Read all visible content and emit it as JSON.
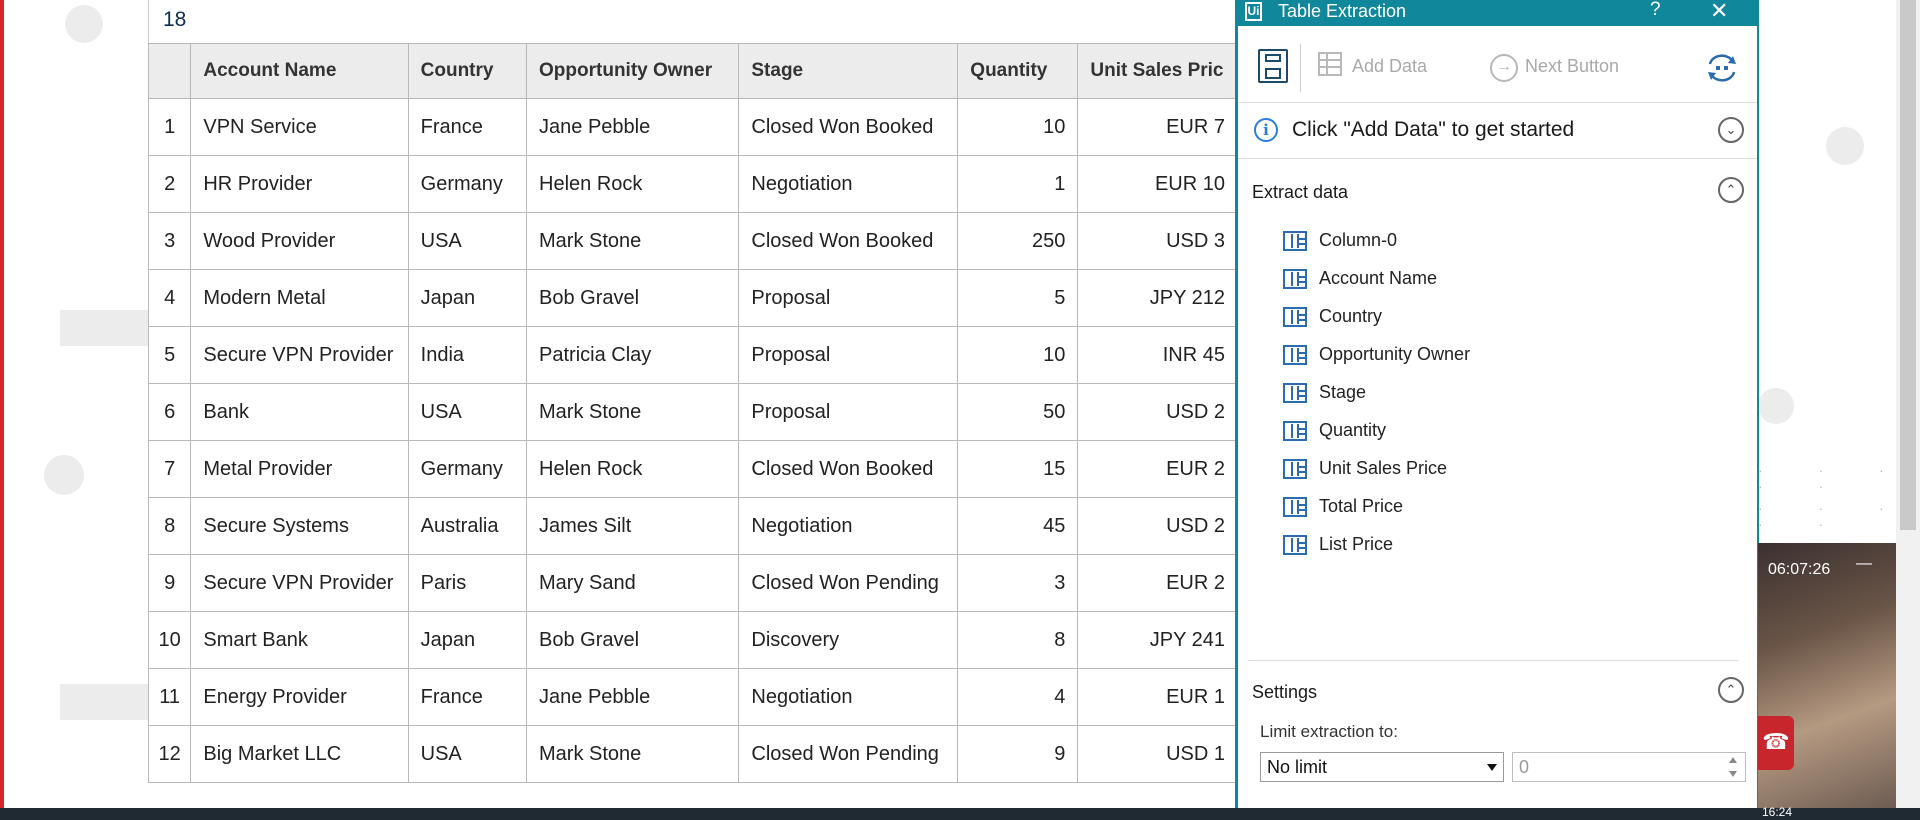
{
  "table": {
    "record_count": "18",
    "columns": [
      "",
      "Account Name",
      "Country",
      "Opportunity Owner",
      "Stage",
      "Quantity",
      "Unit Sales Pric"
    ],
    "rows": [
      [
        "1",
        "VPN Service",
        "France",
        "Jane Pebble",
        "Closed Won Booked",
        "10",
        "EUR 7"
      ],
      [
        "2",
        "HR Provider",
        "Germany",
        "Helen Rock",
        "Negotiation",
        "1",
        "EUR 10"
      ],
      [
        "3",
        "Wood Provider",
        "USA",
        "Mark Stone",
        "Closed Won Booked",
        "250",
        "USD 3"
      ],
      [
        "4",
        "Modern Metal",
        "Japan",
        "Bob Gravel",
        "Proposal",
        "5",
        "JPY 212"
      ],
      [
        "5",
        "Secure VPN Provider",
        "India",
        "Patricia Clay",
        "Proposal",
        "10",
        "INR 45"
      ],
      [
        "6",
        "Bank",
        "USA",
        "Mark Stone",
        "Proposal",
        "50",
        "USD 2"
      ],
      [
        "7",
        "Metal Provider",
        "Germany",
        "Helen Rock",
        "Closed Won Booked",
        "15",
        "EUR 2"
      ],
      [
        "8",
        "Secure Systems",
        "Australia",
        "James Silt",
        "Negotiation",
        "45",
        "USD 2"
      ],
      [
        "9",
        "Secure VPN Provider",
        "Paris",
        "Mary Sand",
        "Closed Won Pending",
        "3",
        "EUR 2"
      ],
      [
        "10",
        "Smart Bank",
        "Japan",
        "Bob Gravel",
        "Discovery",
        "8",
        "JPY 241"
      ],
      [
        "11",
        "Energy Provider",
        "France",
        "Jane Pebble",
        "Negotiation",
        "4",
        "EUR 1"
      ],
      [
        "12",
        "Big Market LLC",
        "USA",
        "Mark Stone",
        "Closed Won Pending",
        "9",
        "USD 1"
      ]
    ]
  },
  "panel": {
    "title": "Table Extraction",
    "logo": "Ui",
    "help_label": "?",
    "close_label": "✕",
    "toolbar": {
      "save_icon": "save-icon",
      "add_data_label": "Add Data",
      "next_button_label": "Next Button",
      "refresh_icon": "refresh-icon"
    },
    "info_message": "Click \"Add Data\" to get started",
    "extract_section_title": "Extract data",
    "fields": [
      "Column-0",
      "Account Name",
      "Country",
      "Opportunity Owner",
      "Stage",
      "Quantity",
      "Unit Sales Price",
      "Total Price",
      "List Price"
    ],
    "settings_title": "Settings",
    "limit_label": "Limit extraction to:",
    "limit_value": "No limit",
    "limit_count": "0"
  },
  "video": {
    "timer": "06:07:26",
    "minimize_label": "—"
  },
  "taskbar": {
    "clock": "16:24"
  },
  "colors": {
    "panel_accent": "#11879c",
    "icon_blue": "#2b6cb0",
    "edge_red": "#d7262b"
  }
}
